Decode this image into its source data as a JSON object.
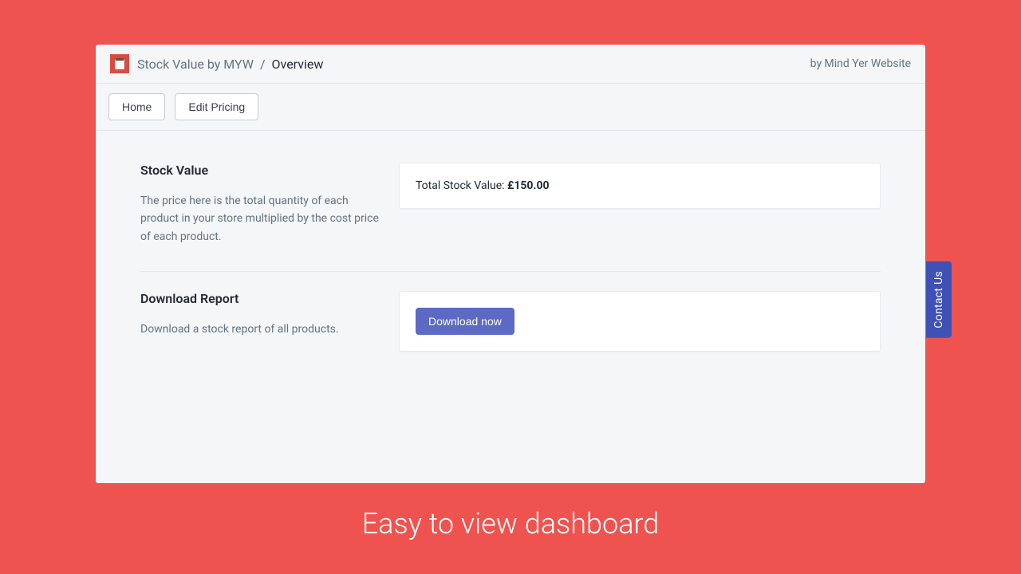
{
  "header": {
    "app_name": "Stock Value by MYW",
    "breadcrumb_sep": "/",
    "current_page": "Overview",
    "byline": "by Mind Yer Website"
  },
  "toolbar": {
    "home_label": "Home",
    "edit_pricing_label": "Edit Pricing"
  },
  "sections": {
    "stock_value": {
      "title": "Stock Value",
      "description": "The price here is the total quantity of each product in your store multiplied by the cost price of each product.",
      "card_label": "Total Stock Value: ",
      "card_value": "£150.00"
    },
    "download_report": {
      "title": "Download Report",
      "description": "Download a stock report of all products.",
      "button_label": "Download now"
    }
  },
  "contact_tab": "Contact Us",
  "caption": "Easy to view dashboard"
}
